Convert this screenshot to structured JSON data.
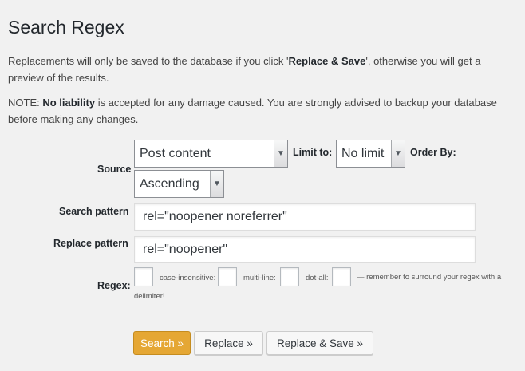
{
  "page": {
    "title": "Search Regex"
  },
  "intro": {
    "text_before": "Replacements will only be saved to the database if you click '",
    "emphasis": "Replace & Save",
    "text_after": "', otherwise you will get a preview of the results."
  },
  "notice": {
    "prefix": "NOTE: ",
    "emphasis": "No liability",
    "text_after": " is accepted for any damage caused. You are strongly advised to backup your database before making any changes."
  },
  "form": {
    "source": {
      "label": "Source",
      "value": "Post content"
    },
    "limit": {
      "label": "Limit to:",
      "value": "No limit"
    },
    "order": {
      "label": "Order By:",
      "value": "Ascending"
    },
    "search_pattern": {
      "label": "Search pattern",
      "value": "rel=\"noopener noreferrer\""
    },
    "replace_pattern": {
      "label": "Replace pattern",
      "value": "rel=\"noopener\""
    },
    "regex": {
      "label": "Regex:",
      "case_insensitive": "case-insensitive:",
      "multi_line": "multi-line:",
      "dot_all": "dot-all:",
      "hint": "— remember to surround your regex with a",
      "hint_2": "delimiter!"
    }
  },
  "buttons": {
    "search": "Search »",
    "replace": "Replace »",
    "replace_save": "Replace & Save »"
  },
  "colors": {
    "background": "#f1f1f1",
    "primary_button": "#e5a734"
  }
}
